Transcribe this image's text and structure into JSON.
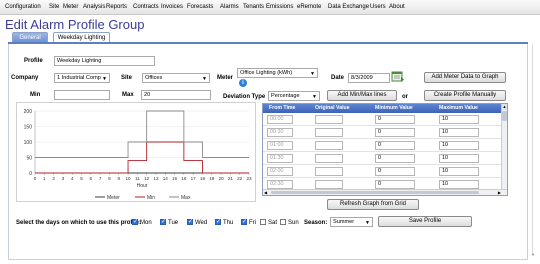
{
  "menu": [
    "Configuration",
    "Site",
    "Meter",
    "Analysis",
    "Reports",
    "Contracts",
    "Invoices",
    "Forecasts",
    "Alarms",
    "Tenants",
    "Emissions",
    "eRemote",
    "Data Exchange",
    "Users",
    "About"
  ],
  "page_title": "Edit Alarm Profile Group",
  "tabs": {
    "general": "General",
    "weekday": "Weekday Lighting"
  },
  "form": {
    "profile_label": "Profile",
    "profile_value": "Weekday Lighting",
    "company_label": "Company",
    "company_value": "1 Industrial Comp",
    "site_label": "Site",
    "site_value": "Offices",
    "meter_label": "Meter",
    "meter_value": "Office Lighting (kWh)",
    "date_label": "Date",
    "date_value": "8/3/2009",
    "add_meter_btn": "Add Meter Data to Graph",
    "min_label": "Min",
    "min_value": "",
    "max_label": "Max",
    "max_value": "20",
    "deviation_label": "Deviation Type",
    "deviation_value": "Percentage",
    "add_minmax_btn": "Add Min/Max lines",
    "or_label": "or",
    "create_profile_btn": "Create Profile Manually"
  },
  "chart_data": {
    "type": "line",
    "x": [
      0,
      1,
      2,
      3,
      4,
      5,
      6,
      7,
      8,
      9,
      10,
      11,
      12,
      13,
      14,
      15,
      16,
      17,
      18,
      19,
      20,
      21,
      22,
      23
    ],
    "xlabel": "Hour",
    "ylim": [
      0,
      200
    ],
    "yticks": [
      0,
      50,
      100,
      150,
      200
    ],
    "series": [
      {
        "name": "Meter",
        "color": "#3c3c3c",
        "values": [
          0,
          0,
          0,
          0,
          0,
          0,
          0,
          0,
          0,
          0,
          0,
          0,
          0,
          0,
          0,
          0,
          0,
          0,
          0,
          0,
          0,
          0,
          0,
          0
        ]
      },
      {
        "name": "Min",
        "color": "#b3202a",
        "values": [
          0,
          0,
          0,
          0,
          0,
          0,
          0,
          0,
          0,
          0,
          40,
          40,
          100,
          100,
          100,
          100,
          40,
          40,
          0,
          0,
          0,
          0,
          0,
          0
        ]
      },
      {
        "name": "Max",
        "color": "#8a8a8a",
        "values": [
          50,
          50,
          50,
          50,
          50,
          50,
          50,
          50,
          50,
          50,
          100,
          100,
          200,
          200,
          200,
          200,
          100,
          100,
          50,
          50,
          50,
          50,
          50,
          50
        ]
      }
    ],
    "legend": "bottom"
  },
  "grid": {
    "headers": [
      "From Time",
      "Original Value",
      "Minimum Value",
      "Maximum Value"
    ],
    "rows": [
      {
        "time": "00:00",
        "original": "",
        "min": "0",
        "max": "10"
      },
      {
        "time": "00:30",
        "original": "",
        "min": "0",
        "max": "10"
      },
      {
        "time": "01:00",
        "original": "",
        "min": "0",
        "max": "10"
      },
      {
        "time": "01:30",
        "original": "",
        "min": "0",
        "max": "10"
      },
      {
        "time": "02:00",
        "original": "",
        "min": "0",
        "max": "10"
      },
      {
        "time": "02:30",
        "original": "",
        "min": "0",
        "max": "10"
      }
    ]
  },
  "refresh_btn": "Refresh Graph from Grid",
  "days_label": "Select the days on which to use this profile:",
  "days": [
    {
      "label": "Mon",
      "checked": true
    },
    {
      "label": "Tue",
      "checked": true
    },
    {
      "label": "Wed",
      "checked": true
    },
    {
      "label": "Thu",
      "checked": true
    },
    {
      "label": "Fri",
      "checked": true
    },
    {
      "label": "Sat",
      "checked": false
    },
    {
      "label": "Sun",
      "checked": false
    }
  ],
  "season_label": "Season:",
  "season_value": "Summer",
  "save_btn": "Save Profile"
}
